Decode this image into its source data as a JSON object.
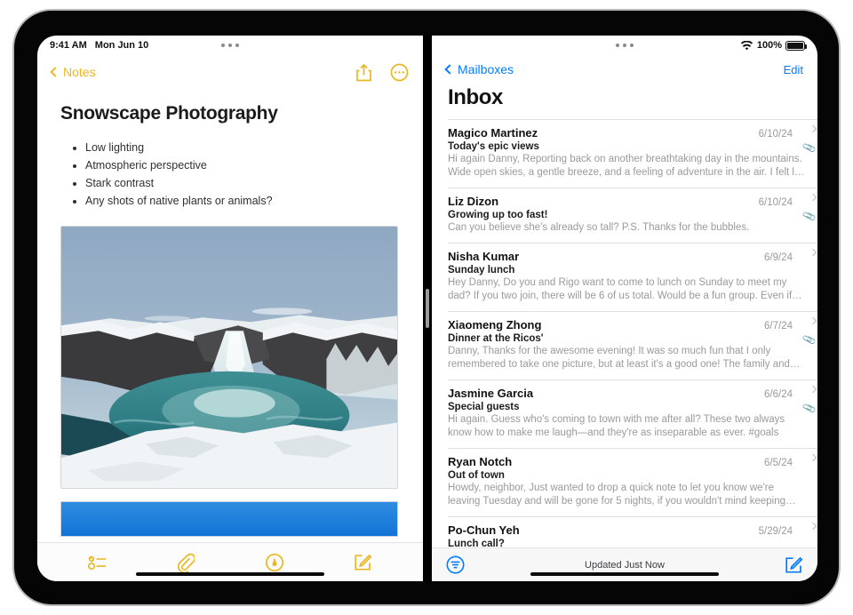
{
  "notes": {
    "statusbar": {
      "time": "9:41 AM",
      "date": "Mon Jun 10",
      "multitask_icon": "three-dots-icon"
    },
    "nav": {
      "back_label": "Notes",
      "back_icon": "chevron-left-icon",
      "share_icon": "share-icon",
      "more_icon": "more-circle-icon"
    },
    "note": {
      "title": "Snowscape Photography",
      "bullets": [
        "Low lighting",
        "Atmospheric perspective",
        "Stark contrast",
        "Any shots of native plants or animals?"
      ],
      "photo_alt": "snowy-waterfall-canyon-photo",
      "attachment_alt": "blue-gradient-image"
    },
    "toolbar": [
      {
        "icon": "checklist-icon"
      },
      {
        "icon": "paperclip-icon"
      },
      {
        "icon": "markup-pen-icon"
      },
      {
        "icon": "compose-icon"
      }
    ],
    "accent": "#E8B723"
  },
  "mail": {
    "statusbar": {
      "multitask_icon": "three-dots-icon",
      "wifi_icon": "wifi-icon",
      "battery_label": "100%",
      "battery_icon": "battery-full-icon"
    },
    "nav": {
      "back_label": "Mailboxes",
      "back_icon": "chevron-left-icon",
      "edit_label": "Edit"
    },
    "title": "Inbox",
    "messages": [
      {
        "sender": "Magico Martinez",
        "date": "6/10/24",
        "subject": "Today's epic views",
        "preview": "Hi again Danny, Reporting back on another breathtaking day in the mountains. Wide open skies, a gentle breeze, and a feeling of adventure in the air. I felt l…",
        "attachment": true
      },
      {
        "sender": "Liz Dizon",
        "date": "6/10/24",
        "subject": "Growing up too fast!",
        "preview": "Can you believe she's already so tall? P.S. Thanks for the bubbles.",
        "attachment": true
      },
      {
        "sender": "Nisha Kumar",
        "date": "6/9/24",
        "subject": "Sunday lunch",
        "preview": "Hey Danny, Do you and Rigo want to come to lunch on Sunday to meet my dad? If you two join, there will be 6 of us total. Would be a fun group. Even if…",
        "attachment": false
      },
      {
        "sender": "Xiaomeng Zhong",
        "date": "6/7/24",
        "subject": "Dinner at the Ricos'",
        "preview": "Danny, Thanks for the awesome evening! It was so much fun that I only remembered to take one picture, but at least it's a good one! The family and…",
        "attachment": true
      },
      {
        "sender": "Jasmine Garcia",
        "date": "6/6/24",
        "subject": "Special guests",
        "preview": "Hi again. Guess who's coming to town with me after all? These two always know how to make me laugh—and they're as inseparable as ever. #goals",
        "attachment": true
      },
      {
        "sender": "Ryan Notch",
        "date": "6/5/24",
        "subject": "Out of town",
        "preview": "Howdy, neighbor, Just wanted to drop a quick note to let you know we're leaving Tuesday and will be gone for 5 nights, if you wouldn't mind keeping…",
        "attachment": false
      },
      {
        "sender": "Po-Chun Yeh",
        "date": "5/29/24",
        "subject": "Lunch call?",
        "preview": "",
        "attachment": false
      }
    ],
    "toolbar": {
      "filter_icon": "filter-icon",
      "status_label": "Updated Just Now",
      "compose_icon": "compose-icon"
    },
    "accent": "#067CFB"
  }
}
